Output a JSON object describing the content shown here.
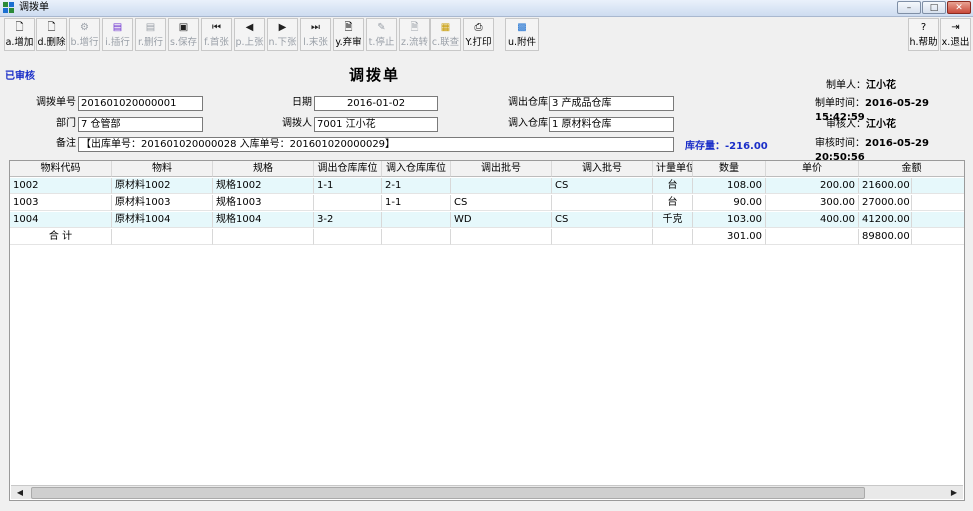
{
  "window": {
    "title": "调拨单",
    "controls": [
      "–",
      "□",
      "✕"
    ]
  },
  "toolbar": {
    "buttons": [
      {
        "label": "a.增加",
        "icon": "add-doc-icon"
      },
      {
        "label": "d.删除",
        "icon": "delete-doc-icon"
      },
      {
        "label": "b.增行",
        "icon": "add-row-icon"
      },
      {
        "label": "i.插行",
        "icon": "insert-row-icon"
      },
      {
        "label": "r.删行",
        "icon": "delete-row-icon"
      },
      {
        "label": "s.保存",
        "icon": "save-icon"
      },
      {
        "label": "f.首张",
        "icon": "first-icon"
      },
      {
        "label": "p.上张",
        "icon": "prev-icon"
      },
      {
        "label": "n.下张",
        "icon": "next-icon"
      },
      {
        "label": "l.末张",
        "icon": "last-icon"
      },
      {
        "label": "y.弃审",
        "icon": "unapprove-icon"
      },
      {
        "label": "t.停止",
        "icon": "stop-icon"
      },
      {
        "label": "z.流转",
        "icon": "transfer-icon"
      },
      {
        "label": "c.联查",
        "icon": "query-icon"
      },
      {
        "label": "Y.打印",
        "icon": "print-icon"
      },
      {
        "label": "u.附件",
        "icon": "attachment-icon"
      },
      {
        "label": "h.帮助",
        "icon": "help-icon"
      },
      {
        "label": "x.退出",
        "icon": "exit-icon"
      }
    ]
  },
  "form": {
    "status": "已审核",
    "title": "调拨单",
    "labels": {
      "doc_no": "调拨单号",
      "date": "日期",
      "out_wh": "调出仓库",
      "dept": "部门",
      "handler": "调拨人",
      "in_wh": "调入仓库",
      "remark": "备注"
    },
    "values": {
      "doc_no": "201601020000001",
      "date": "2016-01-02",
      "out_wh": "3 产成品仓库",
      "dept": "7 仓管部",
      "handler": "7001 江小花",
      "in_wh": "1 原材料仓库",
      "remark": "【出库单号：201601020000028  入库单号：201601020000029】"
    },
    "stock": "库存量：-216.00",
    "info": {
      "maker_label": "制单人：",
      "maker": "江小花",
      "make_time_label": "制单时间：",
      "make_time": "2016-05-29 15:42:59",
      "auditor_label": "审核人：",
      "auditor": "江小花",
      "audit_time_label": "审核时间：",
      "audit_time": "2016-05-29 20:50:56"
    }
  },
  "grid": {
    "columns": [
      "物料代码",
      "物料",
      "规格",
      "调出仓库库位",
      "调入仓库库位",
      "调出批号",
      "调入批号",
      "计量单位",
      "数量",
      "单价",
      "金额"
    ],
    "rows": [
      [
        "1002",
        "原材料1002",
        "规格1002",
        "1-1",
        "2-1",
        "",
        "CS",
        "台",
        "108.00",
        "200.00",
        "21600.00"
      ],
      [
        "1003",
        "原材料1003",
        "规格1003",
        "",
        "1-1",
        "CS",
        "",
        "台",
        "90.00",
        "300.00",
        "27000.00"
      ],
      [
        "1004",
        "原材料1004",
        "规格1004",
        "3-2",
        "",
        "WD",
        "CS",
        "千克",
        "103.00",
        "400.00",
        "41200.00"
      ]
    ],
    "total": [
      "合  计",
      "",
      "",
      "",
      "",
      "",
      "",
      "",
      "301.00",
      "",
      "89800.00"
    ]
  }
}
